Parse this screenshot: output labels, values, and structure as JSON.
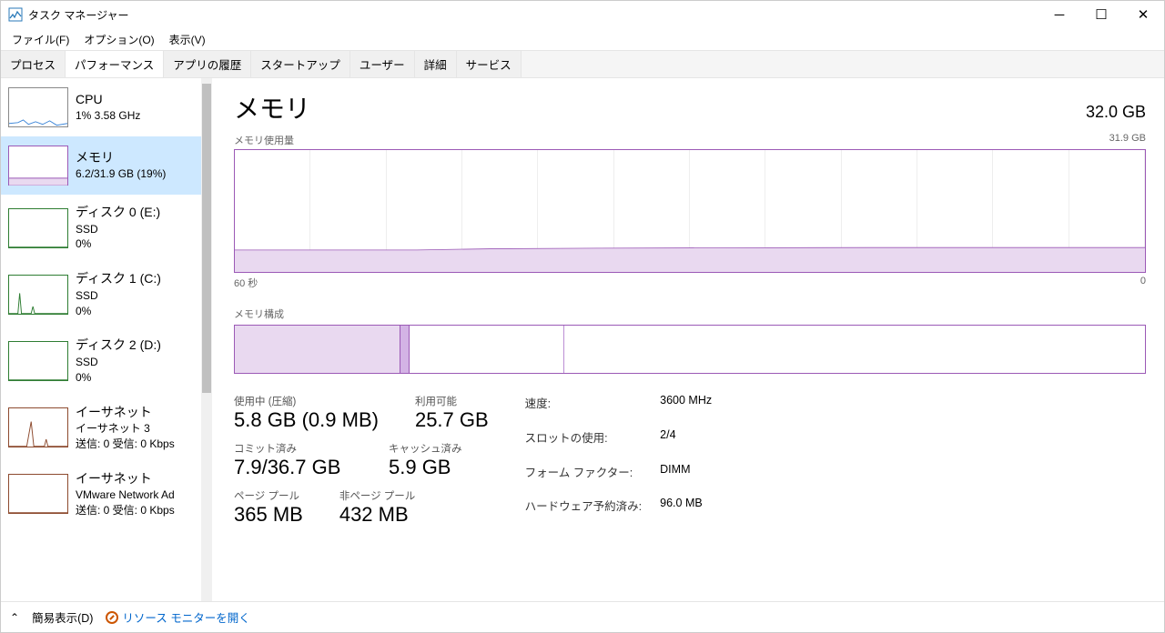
{
  "window": {
    "title": "タスク マネージャー"
  },
  "menu": {
    "file": "ファイル(F)",
    "options": "オプション(O)",
    "view": "表示(V)"
  },
  "tabs": {
    "processes": "プロセス",
    "performance": "パフォーマンス",
    "history": "アプリの履歴",
    "startup": "スタートアップ",
    "users": "ユーザー",
    "details": "詳細",
    "services": "サービス"
  },
  "sidebar": {
    "cpu": {
      "name": "CPU",
      "sub": "1%  3.58 GHz"
    },
    "memory": {
      "name": "メモリ",
      "sub": "6.2/31.9 GB (19%)"
    },
    "disk0": {
      "name": "ディスク 0 (E:)",
      "sub1": "SSD",
      "sub2": "0%"
    },
    "disk1": {
      "name": "ディスク 1 (C:)",
      "sub1": "SSD",
      "sub2": "0%"
    },
    "disk2": {
      "name": "ディスク 2 (D:)",
      "sub1": "SSD",
      "sub2": "0%"
    },
    "eth0": {
      "name": "イーサネット",
      "sub1": "イーサネット 3",
      "sub2": "送信: 0  受信: 0 Kbps"
    },
    "eth1": {
      "name": "イーサネット",
      "sub1": "VMware Network Ad",
      "sub2": "送信: 0  受信: 0 Kbps"
    }
  },
  "main": {
    "title": "メモリ",
    "total": "32.0 GB",
    "usage_label": "メモリ使用量",
    "usage_max": "31.9 GB",
    "time_left": "60 秒",
    "time_right": "0",
    "composition_label": "メモリ構成",
    "stats": {
      "in_use_label": "使用中 (圧縮)",
      "in_use_value": "5.8 GB (0.9 MB)",
      "available_label": "利用可能",
      "available_value": "25.7 GB",
      "committed_label": "コミット済み",
      "committed_value": "7.9/36.7 GB",
      "cached_label": "キャッシュ済み",
      "cached_value": "5.9 GB",
      "paged_label": "ページ プール",
      "paged_value": "365 MB",
      "nonpaged_label": "非ページ プール",
      "nonpaged_value": "432 MB"
    },
    "info": {
      "speed_k": "速度:",
      "speed_v": "3600 MHz",
      "slots_k": "スロットの使用:",
      "slots_v": "2/4",
      "form_k": "フォーム ファクター:",
      "form_v": "DIMM",
      "reserved_k": "ハードウェア予約済み:",
      "reserved_v": "96.0 MB"
    }
  },
  "footer": {
    "fewer": "簡易表示(D)",
    "resmon": "リソース モニターを開く"
  },
  "chart_data": {
    "type": "area",
    "title": "メモリ使用量",
    "xlabel": "秒",
    "ylabel": "GB",
    "x_range_seconds": [
      60,
      0
    ],
    "ylim": [
      0,
      31.9
    ],
    "series": [
      {
        "name": "使用中",
        "approx_value_gb": 6.1,
        "values": [
          5.9,
          5.9,
          5.9,
          5.9,
          5.9,
          5.9,
          6.0,
          6.0,
          6.0,
          6.1,
          6.1,
          6.1,
          6.1,
          6.1,
          6.1,
          6.1,
          6.2,
          6.2,
          6.2,
          6.2,
          6.2,
          6.2,
          6.2,
          6.2,
          6.2
        ]
      }
    ],
    "composition": {
      "type": "stacked-bar",
      "total_gb": 31.9,
      "segments": [
        {
          "name": "使用中",
          "approx_gb": 5.8
        },
        {
          "name": "変更済み",
          "approx_gb": 0.3
        },
        {
          "name": "スタンバイ",
          "approx_gb": 5.4
        },
        {
          "name": "空き",
          "approx_gb": 20.4
        }
      ]
    }
  }
}
